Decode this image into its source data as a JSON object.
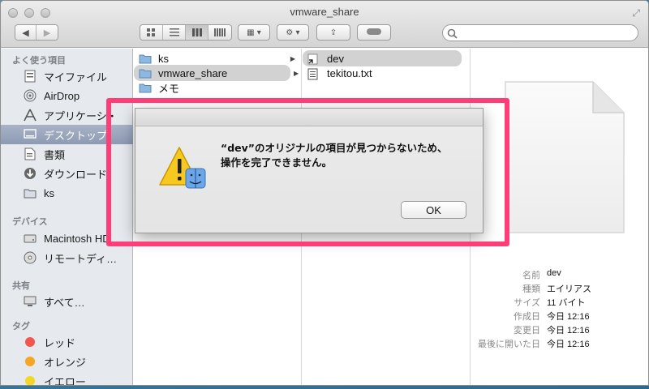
{
  "window": {
    "title": "vmware_share"
  },
  "toolbar": {
    "back_icon": "chevron-left-icon",
    "forward_icon": "chevron-right-icon",
    "view_icons": [
      "icon-view-icon",
      "list-view-icon",
      "column-view-icon",
      "coverflow-view-icon"
    ],
    "search_placeholder": ""
  },
  "sidebar": {
    "favorites_heading": "よく使う項目",
    "favorites": [
      {
        "label": "マイファイル",
        "icon": "all-my-files-icon"
      },
      {
        "label": "AirDrop",
        "icon": "airdrop-icon"
      },
      {
        "label": "アプリケーシ・",
        "icon": "applications-icon"
      },
      {
        "label": "デスクトップ",
        "icon": "desktop-icon",
        "selected": true
      },
      {
        "label": "書類",
        "icon": "documents-icon"
      },
      {
        "label": "ダウンロード",
        "icon": "downloads-icon"
      },
      {
        "label": "ks",
        "icon": "folder-icon"
      }
    ],
    "devices_heading": "デバイス",
    "devices": [
      {
        "label": "Macintosh HD",
        "icon": "hard-drive-icon"
      },
      {
        "label": "リモートディ…",
        "icon": "remote-disc-icon"
      }
    ],
    "shared_heading": "共有",
    "shared": [
      {
        "label": "すべて…",
        "icon": "network-icon"
      }
    ],
    "tags_heading": "タグ",
    "tags": [
      {
        "label": "レッド",
        "color": "#f2574e"
      },
      {
        "label": "オレンジ",
        "color": "#f5a623"
      },
      {
        "label": "イエロー",
        "color": "#f5d623"
      }
    ]
  },
  "columns": {
    "col1": [
      {
        "name": "ks",
        "type": "folder"
      },
      {
        "name": "vmware_share",
        "type": "folder",
        "selected": true
      },
      {
        "name": "メモ",
        "type": "folder"
      }
    ],
    "col2": [
      {
        "name": "dev",
        "type": "alias",
        "selected": true
      },
      {
        "name": "tekitou.txt",
        "type": "text"
      }
    ]
  },
  "info": [
    {
      "key": "名前",
      "value": "dev"
    },
    {
      "key": "種類",
      "value": "エイリアス"
    },
    {
      "key": "サイズ",
      "value": "11 バイト"
    },
    {
      "key": "作成日",
      "value": "今日 12:16"
    },
    {
      "key": "変更日",
      "value": "今日 12:16"
    },
    {
      "key": "最後に開いた日",
      "value": "今日 12:16"
    }
  ],
  "dialog": {
    "line1": "“dev”のオリジナルの項目が見つからないため、",
    "line2": "操作を完了できません。",
    "ok_label": "OK"
  },
  "colors": {
    "highlight": "#ff3d77",
    "selection": "#8d9ab2"
  }
}
